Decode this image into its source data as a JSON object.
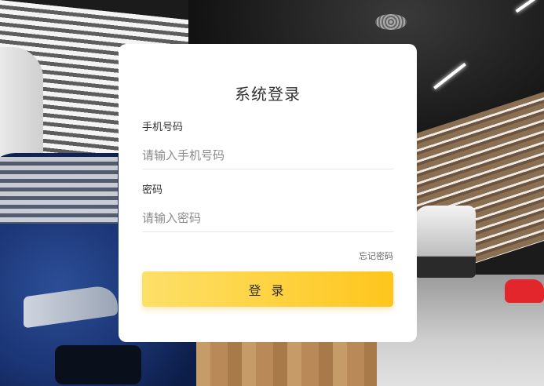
{
  "login": {
    "title": "系统登录",
    "phone": {
      "label": "手机号码",
      "placeholder": "请输入手机号码",
      "value": ""
    },
    "password": {
      "label": "密码",
      "placeholder": "请输入密码",
      "value": ""
    },
    "forgot_label": "忘记密码",
    "submit_label": "登 录"
  },
  "colors": {
    "button_gradient_start": "#fde069",
    "button_gradient_end": "#fec61c",
    "card_background": "#ffffff",
    "title_text": "#333333"
  }
}
